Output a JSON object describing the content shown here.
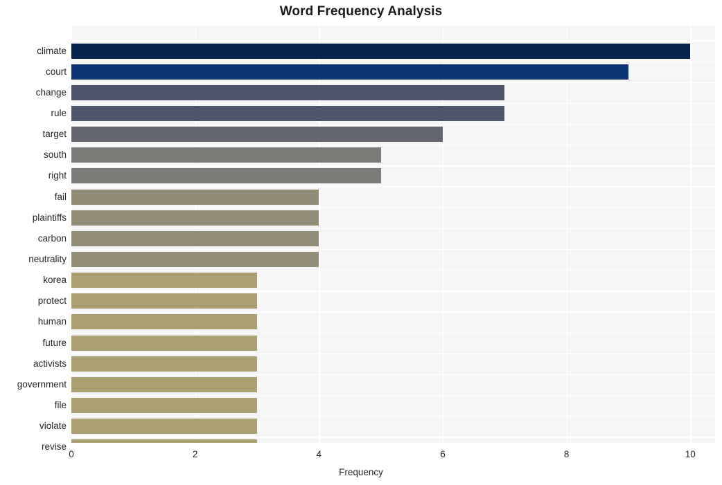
{
  "chart_data": {
    "type": "bar",
    "orientation": "horizontal",
    "title": "Word Frequency Analysis",
    "xlabel": "Frequency",
    "ylabel": "",
    "xlim": [
      0,
      10.4
    ],
    "xticks": [
      0,
      2,
      4,
      6,
      8,
      10
    ],
    "xtick_labels": [
      "0",
      "2",
      "4",
      "6",
      "8",
      "10"
    ],
    "grid": true,
    "legend": null,
    "categories": [
      "climate",
      "court",
      "change",
      "rule",
      "target",
      "south",
      "right",
      "fail",
      "plaintiffs",
      "carbon",
      "neutrality",
      "korea",
      "protect",
      "human",
      "future",
      "activists",
      "government",
      "file",
      "violate",
      "revise"
    ],
    "values": [
      10,
      9,
      7,
      7,
      6,
      5,
      5,
      4,
      4,
      4,
      4,
      3,
      3,
      3,
      3,
      3,
      3,
      3,
      3,
      3
    ],
    "bar_colors": [
      "#05224f",
      "#0c3473",
      "#4e556b",
      "#4e566d",
      "#63666f",
      "#7b7a77",
      "#7c7b78",
      "#918c76",
      "#928d77",
      "#928d77",
      "#938e78",
      "#ab9f6f",
      "#ab9f6f",
      "#ab9f6f",
      "#ab9f6f",
      "#ab9f6f",
      "#ab9f6f",
      "#ab9f6f",
      "#ab9f6f",
      "#ab9f6f"
    ]
  },
  "style": {
    "figure_background": "#ffffff",
    "plot_background": "#f5f5f6",
    "gridline_color": "#ffffff",
    "text_color": "#262626",
    "title_color": "#1a1a1a"
  }
}
